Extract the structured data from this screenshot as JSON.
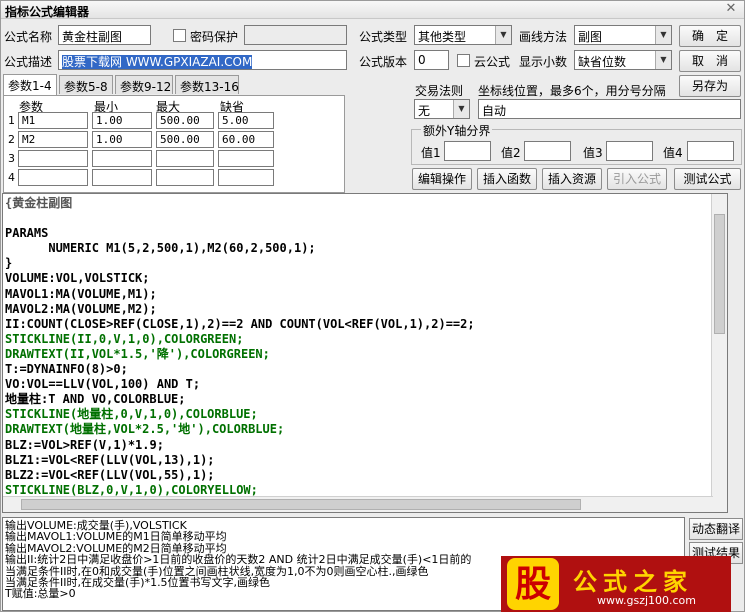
{
  "window": {
    "title": "指标公式编辑器",
    "close_glyph": "✕"
  },
  "form": {
    "name_label": "公式名称",
    "name_value": "黄金柱副图",
    "password_label": "密码保护",
    "desc_label": "公式描述",
    "desc_value": "股票下载网 WWW.GPXIAZAI.COM",
    "type_label": "公式类型",
    "type_value": "其他类型",
    "draw_label": "画线方法",
    "draw_value": "副图",
    "version_label": "公式版本",
    "version_value": "0",
    "cloud_label": "云公式",
    "decimal_label": "显示小数",
    "decimal_value": "缺省位数",
    "trade_rule_label": "交易法则",
    "trade_rule_value": "无",
    "coord_label": "坐标线位置，最多6个，用分号分隔",
    "coord_value": "自动",
    "y_axis_label": "额外Y轴分界",
    "y_values": [
      "值1",
      "值2",
      "值3",
      "值4"
    ]
  },
  "buttons": {
    "ok": "确　定",
    "cancel": "取　消",
    "save_as": "另存为",
    "edit_op": "编辑操作",
    "insert_func": "插入函数",
    "insert_res": "插入资源",
    "import_formula": "引入公式",
    "test_formula": "测试公式",
    "dyn_translate": "动态翻译",
    "test_result": "测试结果"
  },
  "tabs": [
    "参数1-4",
    "参数5-8",
    "参数9-12",
    "参数13-16"
  ],
  "params": {
    "headers": [
      "参数",
      "最小",
      "最大",
      "缺省"
    ],
    "rows": [
      {
        "num": "1",
        "name": "M1",
        "min": "1.00",
        "max": "500.00",
        "default": "5.00"
      },
      {
        "num": "2",
        "name": "M2",
        "min": "1.00",
        "max": "500.00",
        "default": "60.00"
      },
      {
        "num": "3",
        "name": "",
        "min": "",
        "max": "",
        "default": ""
      },
      {
        "num": "4",
        "name": "",
        "min": "",
        "max": "",
        "default": ""
      }
    ]
  },
  "code_lines": [
    {
      "text": "{黄金柱副图",
      "color": "#555555"
    },
    {
      "text": "",
      "color": "#000000"
    },
    {
      "text": "PARAMS",
      "color": "#000000"
    },
    {
      "text": "      NUMERIC M1(5,2,500,1),M2(60,2,500,1);",
      "color": "#000000"
    },
    {
      "text": "}",
      "color": "#000000"
    },
    {
      "text": "VOLUME:VOL,VOLSTICK;",
      "color": "#000000"
    },
    {
      "text": "MAVOL1:MA(VOLUME,M1);",
      "color": "#000000"
    },
    {
      "text": "MAVOL2:MA(VOLUME,M2);",
      "color": "#000000"
    },
    {
      "text": "II:COUNT(CLOSE>REF(CLOSE,1),2)==2 AND COUNT(VOL<REF(VOL,1),2)==2;",
      "color": "#000000"
    },
    {
      "text": "STICKLINE(II,0,V,1,0),COLORGREEN;",
      "color": "#007000"
    },
    {
      "text": "DRAWTEXT(II,VOL*1.5,'降'),COLORGREEN;",
      "color": "#007000"
    },
    {
      "text": "T:=DYNAINFO(8)>0;",
      "color": "#000000"
    },
    {
      "text": "VO:VOL==LLV(VOL,100) AND T;",
      "color": "#000000"
    },
    {
      "text": "地量柱:T AND VO,COLORBLUE;",
      "color": "#000000"
    },
    {
      "text": "STICKLINE(地量柱,0,V,1,0),COLORBLUE;",
      "color": "#007000"
    },
    {
      "text": "DRAWTEXT(地量柱,VOL*2.5,'地'),COLORBLUE;",
      "color": "#007000"
    },
    {
      "text": "BLZ:=VOL>REF(V,1)*1.9;",
      "color": "#000000"
    },
    {
      "text": "BLZ1:=VOL<REF(LLV(VOL,13),1);",
      "color": "#000000"
    },
    {
      "text": "BLZ2:=VOL<REF(LLV(VOL,55),1);",
      "color": "#000000"
    },
    {
      "text": "STICKLINE(BLZ,0,V,1,0),COLORYELLOW;",
      "color": "#007000"
    }
  ],
  "output_lines": [
    "输出VOLUME:成交量(手),VOLSTICK",
    "输出MAVOL1:VOLUME的M1日简单移动平均",
    "输出MAVOL2:VOLUME的M2日简单移动平均",
    "输出II:统计2日中满足收盘价>1日前的收盘价的天数2 AND 统计2日中满足成交量(手)<1日前的",
    "当满足条件II时,在0和成交量(手)位置之间画柱状线,宽度为1,0不为0则画空心柱.,画绿色",
    "当满足条件II时,在成交量(手)*1.5位置书写文字,画绿色",
    "T赋值:总量>0"
  ],
  "watermark": {
    "logo": "股",
    "name": "公式之家",
    "url": "www.gszj100.com"
  }
}
